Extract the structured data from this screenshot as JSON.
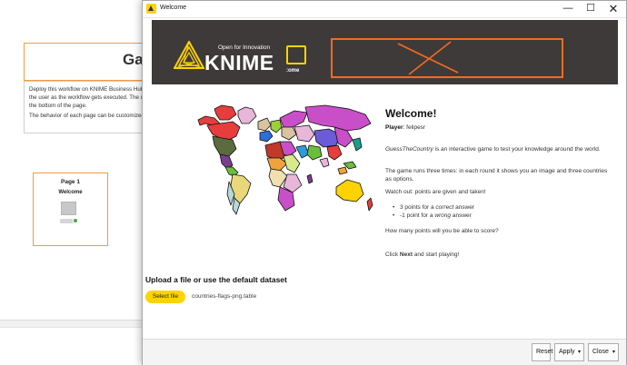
{
  "background": {
    "title_fragment": "Ga",
    "desc_lines": [
      "Deploy this workflow on KNIME Business Hub a",
      "the user as the workflow gets executed. The us",
      "the bottom of the page.",
      "The behavior of each page can be customized a"
    ],
    "page_card": {
      "title": "Page 1",
      "subtitle": "Welcome"
    }
  },
  "window": {
    "title": "Welcome",
    "controls": {
      "minimize": "—",
      "maximize": "☐",
      "close": "✕"
    }
  },
  "banner": {
    "tagline": "Open for Innovation",
    "brand": "KNIME",
    "yellow_label": ":ome",
    "colors": {
      "background": "#3e3a39",
      "accent": "#ffd300",
      "orange": "#f26b21"
    }
  },
  "welcome": {
    "title": "Welcome!",
    "player_label": "Player",
    "player_value": ": felipesr",
    "game_name": "GuessTheCountry",
    "intro_rest": " is an interactive game to test your knowledge around the world.",
    "rules": "The game runs three times: in each round it shows you an image and three countries as options.",
    "watch_out": "Watch out: points are given and taken!",
    "bullet1_pre": "3 points for a ",
    "bullet1_em": "correct",
    "bullet1_post": " answer",
    "bullet2_pre": "-1 point for a ",
    "bullet2_em": "wrong",
    "bullet2_post": " answer",
    "question": "How many points will you be able to score?",
    "cta_pre": "Click ",
    "cta_bold": "Next",
    "cta_post": " and start playing!"
  },
  "upload": {
    "heading": "Upload a file or use the default dataset",
    "button": "Select file",
    "file_name": "countries-flags-png.table"
  },
  "footer": {
    "reset": "Reset",
    "apply": "Apply",
    "close": "Close",
    "caret": "▾"
  }
}
